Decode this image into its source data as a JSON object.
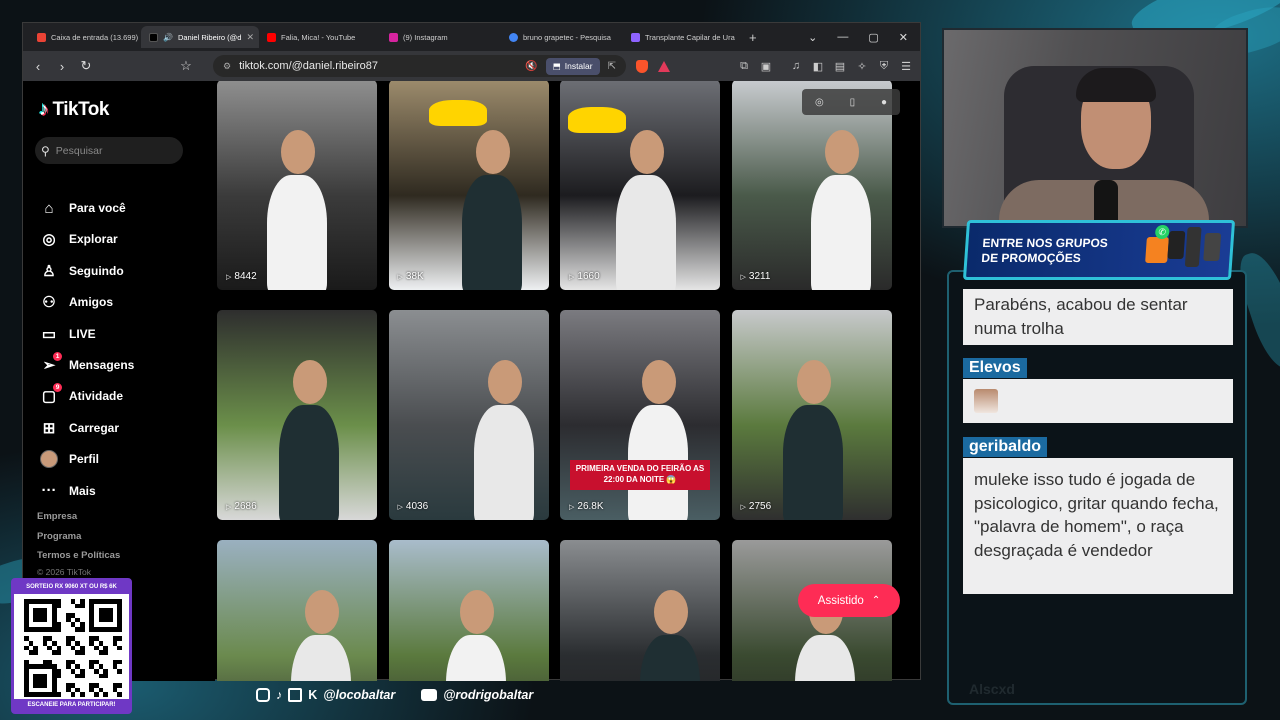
{
  "browser": {
    "tabs": [
      {
        "label": "Caixa de entrada (13.699)",
        "color": "#ea4335",
        "active": false
      },
      {
        "label": "Daniel Ribeiro (@d",
        "color": "#ffffff",
        "active": true
      },
      {
        "label": "Falia, Mica! - YouTube",
        "color": "#ff0000",
        "active": false
      },
      {
        "label": "(9) Instagram",
        "color": "#d6249f",
        "active": false
      },
      {
        "label": "bruno grapetec - Pesquisa",
        "color": "#4285f4",
        "active": false
      },
      {
        "label": "Transplante Capilar de Ura",
        "color": "#8e63ff",
        "active": false
      }
    ],
    "url": "tiktok.com/@daniel.ribeiro87",
    "install_label": "Instalar"
  },
  "tiktok": {
    "brand": "TikTok",
    "search_placeholder": "Pesquisar",
    "nav": [
      {
        "label": "Para você",
        "icon": "home-icon",
        "badge": ""
      },
      {
        "label": "Explorar",
        "icon": "compass-icon",
        "badge": ""
      },
      {
        "label": "Seguindo",
        "icon": "following-icon",
        "badge": ""
      },
      {
        "label": "Amigos",
        "icon": "friends-icon",
        "badge": ""
      },
      {
        "label": "LIVE",
        "icon": "live-icon",
        "badge": ""
      },
      {
        "label": "Mensagens",
        "icon": "messages-icon",
        "badge": "1"
      },
      {
        "label": "Atividade",
        "icon": "activity-icon",
        "badge": "9"
      },
      {
        "label": "Carregar",
        "icon": "upload-icon",
        "badge": ""
      },
      {
        "label": "Perfil",
        "icon": "profile-avatar",
        "badge": ""
      },
      {
        "label": "Mais",
        "icon": "more-icon",
        "badge": ""
      }
    ],
    "footer": [
      "Empresa",
      "Programa",
      "Termos e Políticas"
    ],
    "copyright": "© 2026 TikTok",
    "assistido_label": "Assistido",
    "videos": [
      {
        "views": "8442",
        "caption": ""
      },
      {
        "views": "38K",
        "caption": ""
      },
      {
        "views": "1660",
        "caption": ""
      },
      {
        "views": "3211",
        "caption": ""
      },
      {
        "views": "2686",
        "caption": ""
      },
      {
        "views": "4036",
        "caption": ""
      },
      {
        "views": "26.8K",
        "caption": "PRIMEIRA VENDA DO FEIRÃO AS 22:00 DA NOITE 😱"
      },
      {
        "views": "2756",
        "caption": ""
      },
      {
        "views": "",
        "caption": ""
      },
      {
        "views": "",
        "caption": ""
      },
      {
        "views": "",
        "caption": ""
      },
      {
        "views": "",
        "caption": ""
      }
    ]
  },
  "overlay": {
    "promo_text": "ENTRE NOS GRUPOS\nDE PROMOÇÕES",
    "chat": {
      "messages": [
        {
          "author": "",
          "text": "Parabéns, acabou de sentar numa trolha"
        },
        {
          "author": "Elevos",
          "text": ""
        },
        {
          "author": "geribaldo",
          "text": "muleke isso tudo é jogada de psicologico, gritar quando fecha, \"palavra de homem\", o raça desgraçada é vendedor"
        }
      ],
      "faded_name": "Alscxd"
    },
    "qr": {
      "header": "SORTEIO RX 9060 XT OU R$ 6K",
      "footer": "ESCANEIE PARA PARTICIPAR!"
    },
    "socials": {
      "handle1": "@locobaltar",
      "handle2": "@rodrigobaltar"
    }
  }
}
